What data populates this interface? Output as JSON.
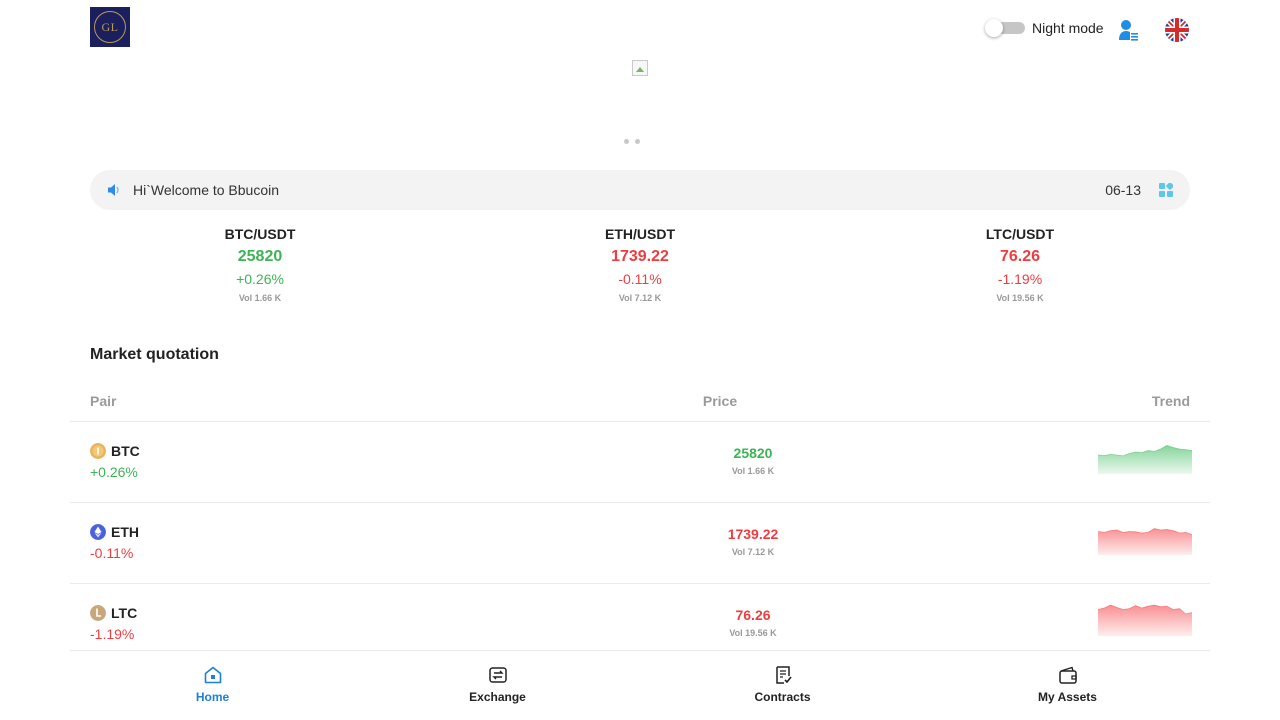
{
  "header": {
    "logo_text": "GL",
    "night_mode_label": "Night mode",
    "night_mode_on": false,
    "user_icon": "user-list-icon",
    "language_icon": "uk-flag-icon"
  },
  "banner": {
    "image_icon": "broken-image-icon",
    "slide_count": 2
  },
  "notice": {
    "icon": "speaker-icon",
    "text": "Hi`Welcome to Bbucoin",
    "date": "06-13",
    "grid_icon": "grid-icon"
  },
  "tickers": [
    {
      "pair": "BTC/USDT",
      "price": "25820",
      "change": "+0.26%",
      "vol": "Vol 1.66 K",
      "direction": "up"
    },
    {
      "pair": "ETH/USDT",
      "price": "1739.22",
      "change": "-0.11%",
      "vol": "Vol 7.12 K",
      "direction": "down"
    },
    {
      "pair": "LTC/USDT",
      "price": "76.26",
      "change": "-1.19%",
      "vol": "Vol 19.56 K",
      "direction": "down"
    }
  ],
  "market": {
    "title": "Market quotation",
    "columns": {
      "pair": "Pair",
      "price": "Price",
      "trend": "Trend"
    },
    "rows": [
      {
        "coin": "BTC",
        "change": "+0.26%",
        "price": "25820",
        "vol": "Vol 1.66 K",
        "direction": "up",
        "icon": "btc-coin-icon",
        "trend": [
          0.3,
          0.28,
          0.32,
          0.3,
          0.27,
          0.35,
          0.4,
          0.38,
          0.45,
          0.42,
          0.5,
          0.62,
          0.55,
          0.5,
          0.48,
          0.45
        ]
      },
      {
        "coin": "ETH",
        "change": "-0.11%",
        "price": "1739.22",
        "vol": "Vol 7.12 K",
        "direction": "down",
        "icon": "eth-coin-icon",
        "trend": [
          0.45,
          0.42,
          0.48,
          0.5,
          0.42,
          0.45,
          0.44,
          0.4,
          0.42,
          0.55,
          0.5,
          0.52,
          0.48,
          0.4,
          0.42,
          0.35
        ]
      },
      {
        "coin": "LTC",
        "change": "-1.19%",
        "price": "76.26",
        "vol": "Vol 19.56 K",
        "direction": "down",
        "icon": "ltc-coin-icon",
        "trend": [
          0.55,
          0.6,
          0.7,
          0.62,
          0.55,
          0.58,
          0.68,
          0.6,
          0.66,
          0.7,
          0.64,
          0.66,
          0.55,
          0.58,
          0.4,
          0.45
        ]
      }
    ]
  },
  "nav": [
    {
      "label": "Home",
      "icon": "home-icon",
      "active": true
    },
    {
      "label": "Exchange",
      "icon": "exchange-icon",
      "active": false
    },
    {
      "label": "Contracts",
      "icon": "contracts-icon",
      "active": false
    },
    {
      "label": "My Assets",
      "icon": "wallet-icon",
      "active": false
    }
  ],
  "colors": {
    "up": "#3cb455",
    "down": "#ee3d40",
    "accent": "#1e7fd8",
    "up_fill": "#7ed393",
    "down_fill": "#f88a8c"
  }
}
